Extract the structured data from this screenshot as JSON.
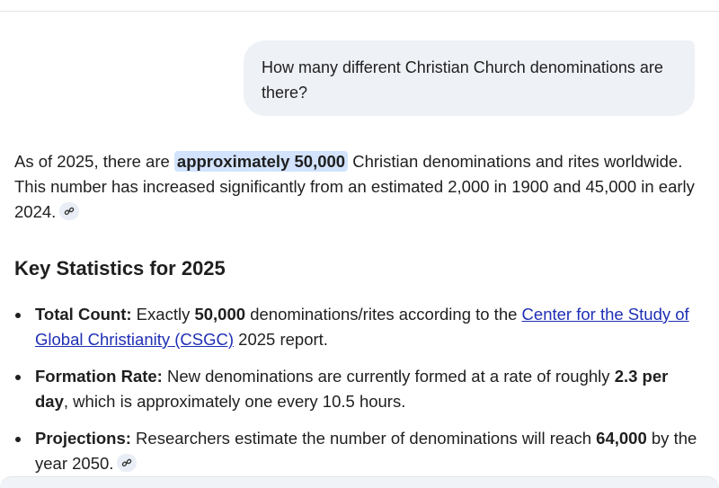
{
  "user_message": "How many different Christian Church denominations are there?",
  "answer": {
    "p1_before": "As of 2025, there are ",
    "p1_highlight": "approximately 50,000",
    "p1_after": " Christian denominations and rites worldwide. This number has increased significantly from an estimated 2,000 in 1900 and 45,000 in early 2024."
  },
  "heading": "Key Statistics for 2025",
  "items": [
    {
      "label": "Total Count:",
      "t1": " Exactly ",
      "b1": "50,000",
      "t2": " denominations/rites according to the ",
      "link": "Center for the Study of Global Christianity (CSGC)",
      "t3": " 2025 report."
    },
    {
      "label": "Formation Rate:",
      "t1": " New denominations are currently formed at a rate of roughly ",
      "b1": "2.3 per day",
      "t2": ", which is approximately one every 10.5 hours."
    },
    {
      "label": "Projections:",
      "t1": " Researchers estimate the number of denominations will reach ",
      "b1": "64,000",
      "t2": " by the year 2050."
    }
  ],
  "icons": {
    "citation": "link-icon"
  },
  "colors": {
    "highlight": "#d3e3fd",
    "bubble": "#eef1f6",
    "link": "#1f2fb5"
  }
}
